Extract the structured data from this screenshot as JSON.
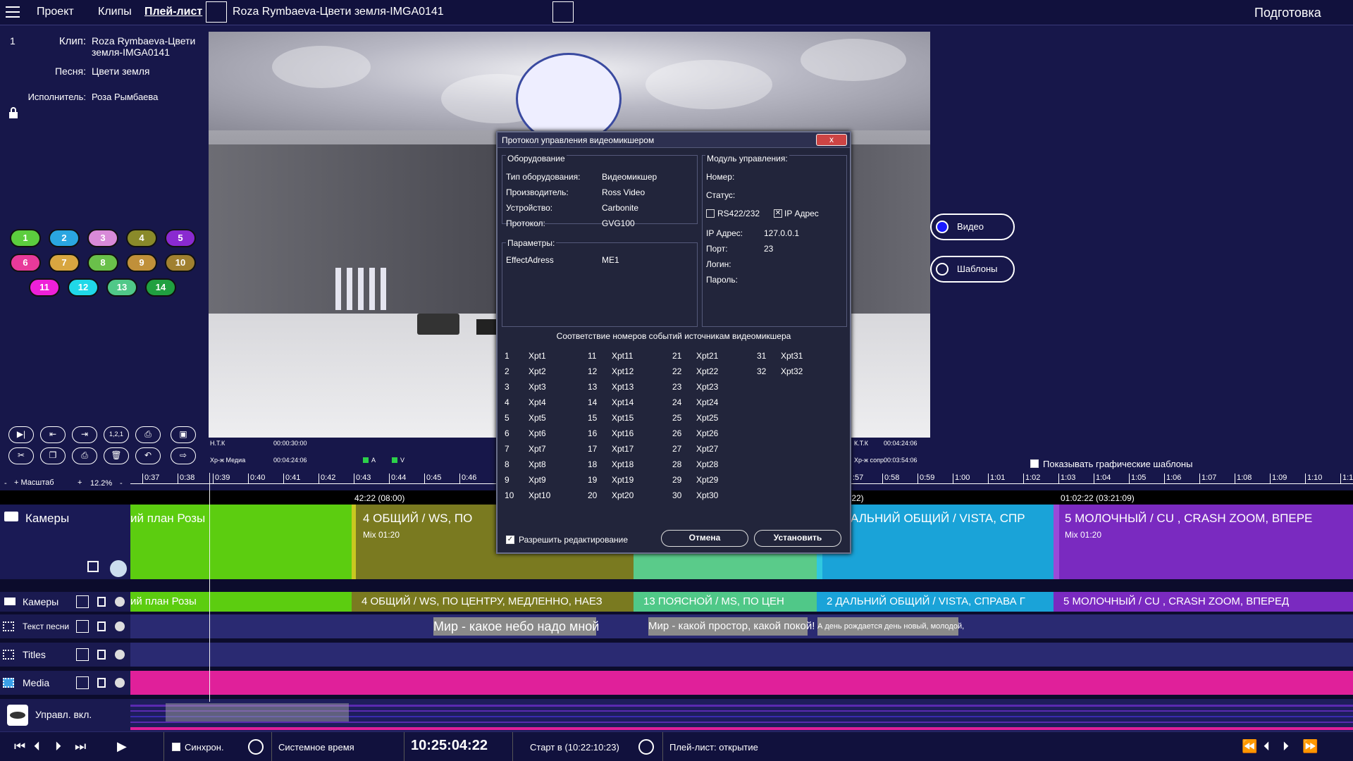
{
  "topbar": {
    "nav": [
      "Проект",
      "Клипы",
      "Плей-лист"
    ],
    "title": "Roza Rymbaeva-Цвети земля-IMGA0141",
    "mode": "Подготовка"
  },
  "clip_info": {
    "number": "1",
    "clip_label": "Клип:",
    "clip_value": "Roza Rymbaeva-Цвети земля-IMGA0141",
    "song_label": "Песня:",
    "song_value": "Цвети земля",
    "artist_label": "Исполнитель:",
    "artist_value": "Роза Рымбаева"
  },
  "pills": [
    {
      "label": "1",
      "color": "#5ccd3e"
    },
    {
      "label": "2",
      "color": "#2aa6e0"
    },
    {
      "label": "3",
      "color": "#d88ad8"
    },
    {
      "label": "4",
      "color": "#8a8a2a"
    },
    {
      "label": "5",
      "color": "#8a2ad0"
    },
    {
      "label": "6",
      "color": "#e83a9a"
    },
    {
      "label": "7",
      "color": "#d8a640"
    },
    {
      "label": "8",
      "color": "#6ac04a"
    },
    {
      "label": "9",
      "color": "#c0903a"
    },
    {
      "label": "10",
      "color": "#a08030"
    },
    {
      "label": "11",
      "color": "#ee20d8"
    },
    {
      "label": "12",
      "color": "#20d8e8"
    },
    {
      "label": "13",
      "color": "#50c888"
    },
    {
      "label": "14",
      "color": "#20a040"
    }
  ],
  "video": {
    "tc_left_top_label": "Н.Т.К",
    "tc_left_top": "00:00:30:00",
    "tc_left_bottom_label": "Хр-ж Медиа",
    "tc_left_bottom": "00:04:24:06",
    "flag_a": "A",
    "flag_v": "V",
    "tc_right_top_label": "К.Т.К",
    "tc_right_top": "00:04:24:06",
    "tc_right_bottom_label": "Хр-ж сопр.",
    "tc_right_bottom": "00:03:54:06"
  },
  "dialog": {
    "title": "Протокол управления видеомикшером",
    "close": "x",
    "equipment": {
      "title": "Оборудование",
      "rows": [
        {
          "label": "Тип оборудования:",
          "value": "Видеомикшер"
        },
        {
          "label": "Производитель:",
          "value": "Ross Video"
        },
        {
          "label": "Устройство:",
          "value": "Carbonite"
        },
        {
          "label": "Протокол:",
          "value": "GVG100"
        }
      ]
    },
    "params": {
      "title": "Параметры:",
      "label": "EffectAdress",
      "value": "ME1"
    },
    "module": {
      "title": "Модуль управления:",
      "number_label": "Номер:",
      "status_label": "Статус:",
      "rs_label": "RS422/232",
      "ip_check_label": "IP Адрес",
      "ip_label": "IP Адрес:",
      "ip_value": "127.0.0.1",
      "port_label": "Порт:",
      "port_value": "23",
      "login_label": "Логин:",
      "password_label": "Пароль:"
    },
    "mapping_title": "Соответствие номеров событий источникам видеомикшера",
    "mapping": [
      {
        "n": "1",
        "x": "Xpt1"
      },
      {
        "n": "2",
        "x": "Xpt2"
      },
      {
        "n": "3",
        "x": "Xpt3"
      },
      {
        "n": "4",
        "x": "Xpt4"
      },
      {
        "n": "5",
        "x": "Xpt5"
      },
      {
        "n": "6",
        "x": "Xpt6"
      },
      {
        "n": "7",
        "x": "Xpt7"
      },
      {
        "n": "8",
        "x": "Xpt8"
      },
      {
        "n": "9",
        "x": "Xpt9"
      },
      {
        "n": "10",
        "x": "Xpt10"
      },
      {
        "n": "11",
        "x": "Xpt11"
      },
      {
        "n": "12",
        "x": "Xpt12"
      },
      {
        "n": "13",
        "x": "Xpt13"
      },
      {
        "n": "14",
        "x": "Xpt14"
      },
      {
        "n": "15",
        "x": "Xpt15"
      },
      {
        "n": "16",
        "x": "Xpt16"
      },
      {
        "n": "17",
        "x": "Xpt17"
      },
      {
        "n": "18",
        "x": "Xpt18"
      },
      {
        "n": "19",
        "x": "Xpt19"
      },
      {
        "n": "20",
        "x": "Xpt20"
      },
      {
        "n": "21",
        "x": "Xpt21"
      },
      {
        "n": "22",
        "x": "Xpt22"
      },
      {
        "n": "23",
        "x": "Xpt23"
      },
      {
        "n": "24",
        "x": "Xpt24"
      },
      {
        "n": "25",
        "x": "Xpt25"
      },
      {
        "n": "26",
        "x": "Xpt26"
      },
      {
        "n": "27",
        "x": "Xpt27"
      },
      {
        "n": "28",
        "x": "Xpt28"
      },
      {
        "n": "29",
        "x": "Xpt29"
      },
      {
        "n": "30",
        "x": "Xpt30"
      },
      {
        "n": "31",
        "x": "Xpt31"
      },
      {
        "n": "32",
        "x": "Xpt32"
      }
    ],
    "allow_edit": "Разрешить редактирование",
    "cancel": "Отмена",
    "apply": "Установить"
  },
  "right_panel": {
    "video_toggle": "Видео",
    "templates_toggle": "Шаблоны",
    "show_templates": "Показывать графические шаблоны"
  },
  "scale": {
    "minus": "-",
    "plus_label": "+ Масштаб",
    "plus2": "+",
    "value": "12.2%",
    "minus2": "-"
  },
  "ruler": {
    "ticks_left": [
      "0:37",
      "0:38",
      "0:39",
      "0:40",
      "0:41",
      "0:42",
      "0:43",
      "0:44",
      "0:45",
      "0:46"
    ],
    "ticks_right": [
      ":57",
      "0:58",
      "0:59",
      "1:00",
      "1:01",
      "1:02",
      "1:03",
      "1:04",
      "1:05",
      "1:06",
      "1:07",
      "1:08",
      "1:09",
      "1:10",
      "1:1"
    ]
  },
  "timeline_marks": {
    "mark1": "42:22 (08:00)",
    "mark2": ":22)",
    "mark3": "01:02:22 (03:21:09)"
  },
  "camera_track": {
    "label": "Камеры",
    "segments": [
      {
        "title": "ий план Розы",
        "sub": "",
        "color": "#5ccd10"
      },
      {
        "title": "4  ОБЩИЙ  /  WS, ПО",
        "sub": "Mix   01:20",
        "color": "#7a7a20"
      },
      {
        "title": "",
        "sub": "",
        "color": "#5acb8a"
      },
      {
        "title": "АЛЬНИЙ ОБЩИЙ  /  VISTA, СПР",
        "sub": "",
        "color": "#1aa3d8"
      },
      {
        "title": "5  МОЛОЧНЫЙ  /  CU , CRASH ZOOM, ВПЕРЕ",
        "sub": "Mix   01:20",
        "color": "#7a2ac0"
      }
    ]
  },
  "tracks": {
    "cameras": {
      "label": "Камеры",
      "segments": [
        {
          "title": "ий план Розы",
          "color": "#5ccd10"
        },
        {
          "title": "4   ОБЩИЙ  /  WS, ПО ЦЕНТРУ, МЕДЛЕННО, НАЕЗ",
          "color": "#7a7a20"
        },
        {
          "title": "13   ПОЯСНОЙ  /  MS, ПО ЦЕН",
          "color": "#50c888"
        },
        {
          "title": "2   ДАЛЬНИЙ ОБЩИЙ  /  VISTA, СПРАВА Г",
          "color": "#1aa3d8"
        },
        {
          "title": "5   МОЛОЧНЫЙ  /  CU , CRASH ZOOM, ВПЕРЕД",
          "color": "#7a2ac0"
        }
      ]
    },
    "lyrics": {
      "label": "Текст песни",
      "items": [
        "Мир - какое небо надо мной",
        "Мир - какой простор, какой покой!",
        "А день рождается день новый, молодой,"
      ]
    },
    "titles": {
      "label": "Titles"
    },
    "media": {
      "label": "Media"
    },
    "control": {
      "label": "Управл. вкл."
    }
  },
  "bottombar": {
    "sync": "Синхрон.",
    "system_time_label": "Системное время",
    "system_time": "10:25:04:22",
    "start": "Старт в (10:22:10:23)",
    "playlist_status": "Плей-лист: открытие"
  }
}
